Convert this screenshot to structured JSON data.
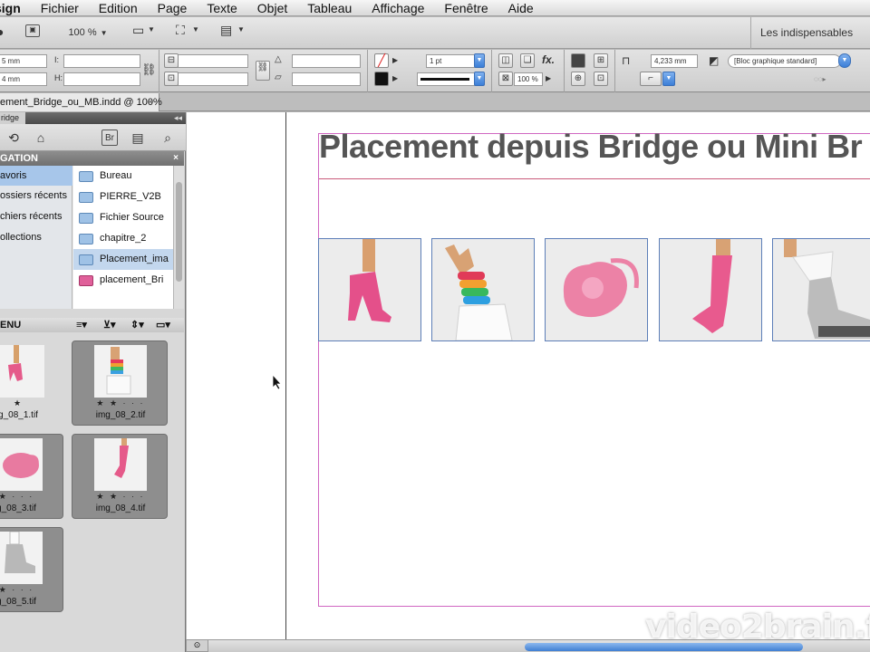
{
  "menubar": {
    "app_name": "sign",
    "items": [
      "Fichier",
      "Edition",
      "Page",
      "Texte",
      "Objet",
      "Tableau",
      "Affichage",
      "Fenêtre",
      "Aide"
    ]
  },
  "appbar": {
    "zoom": "100 %",
    "workspace": "Les indispensables"
  },
  "control": {
    "x_val": "5 mm",
    "y_val": "4 mm",
    "stroke_weight": "1 pt",
    "opacity": "100 %",
    "gutter": "4,233 mm",
    "object_style": "[Bloc graphique standard]"
  },
  "doc_tab": {
    "label": "ement_Bridge_ou_MB.indd @ 100%"
  },
  "panel": {
    "title": "ridge",
    "nav_header": "GATION",
    "favorites": [
      "avoris",
      "ossiers récents",
      "chiers récents",
      "ollections"
    ],
    "folders": [
      "Bureau",
      "PIERRE_V2B",
      "Fichier Source",
      "chapitre_2",
      "Placement_ima",
      "placement_Bri"
    ],
    "content_header": "ENU",
    "thumbnails": [
      {
        "name": "g_08_1.tif",
        "stars": "★"
      },
      {
        "name": "img_08_2.tif",
        "stars": "★ ★ · · ·"
      },
      {
        "name": "g_08_3.tif",
        "stars": "★ · · ·"
      },
      {
        "name": "img_08_4.tif",
        "stars": "★ ★ · · ·"
      },
      {
        "name": "g_08_5.tif",
        "stars": "★ · · ·"
      }
    ]
  },
  "page": {
    "title": "Placement depuis Bridge ou Mini Br"
  },
  "watermark": "video2brain.fr",
  "colors": {
    "margin_guide": "#d067c2",
    "frame_border": "#5d7fb8",
    "selection": "#a7c6ea",
    "doll_pink": "#e55a8a"
  }
}
